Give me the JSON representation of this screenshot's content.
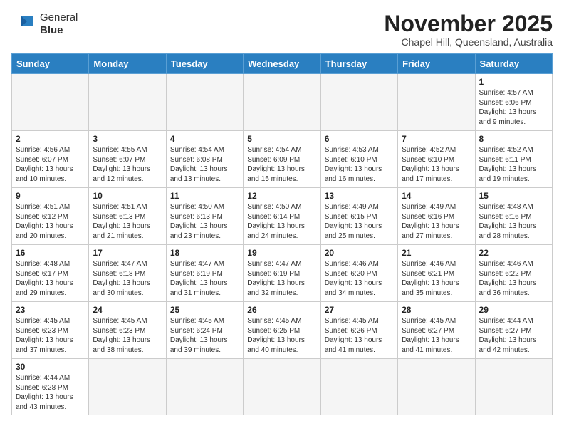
{
  "header": {
    "logo_general": "General",
    "logo_blue": "Blue",
    "month_title": "November 2025",
    "subtitle": "Chapel Hill, Queensland, Australia"
  },
  "days_of_week": [
    "Sunday",
    "Monday",
    "Tuesday",
    "Wednesday",
    "Thursday",
    "Friday",
    "Saturday"
  ],
  "weeks": [
    [
      {
        "day": "",
        "info": ""
      },
      {
        "day": "",
        "info": ""
      },
      {
        "day": "",
        "info": ""
      },
      {
        "day": "",
        "info": ""
      },
      {
        "day": "",
        "info": ""
      },
      {
        "day": "",
        "info": ""
      },
      {
        "day": "1",
        "info": "Sunrise: 4:57 AM\nSunset: 6:06 PM\nDaylight: 13 hours and 9 minutes."
      }
    ],
    [
      {
        "day": "2",
        "info": "Sunrise: 4:56 AM\nSunset: 6:07 PM\nDaylight: 13 hours and 10 minutes."
      },
      {
        "day": "3",
        "info": "Sunrise: 4:55 AM\nSunset: 6:07 PM\nDaylight: 13 hours and 12 minutes."
      },
      {
        "day": "4",
        "info": "Sunrise: 4:54 AM\nSunset: 6:08 PM\nDaylight: 13 hours and 13 minutes."
      },
      {
        "day": "5",
        "info": "Sunrise: 4:54 AM\nSunset: 6:09 PM\nDaylight: 13 hours and 15 minutes."
      },
      {
        "day": "6",
        "info": "Sunrise: 4:53 AM\nSunset: 6:10 PM\nDaylight: 13 hours and 16 minutes."
      },
      {
        "day": "7",
        "info": "Sunrise: 4:52 AM\nSunset: 6:10 PM\nDaylight: 13 hours and 17 minutes."
      },
      {
        "day": "8",
        "info": "Sunrise: 4:52 AM\nSunset: 6:11 PM\nDaylight: 13 hours and 19 minutes."
      }
    ],
    [
      {
        "day": "9",
        "info": "Sunrise: 4:51 AM\nSunset: 6:12 PM\nDaylight: 13 hours and 20 minutes."
      },
      {
        "day": "10",
        "info": "Sunrise: 4:51 AM\nSunset: 6:13 PM\nDaylight: 13 hours and 21 minutes."
      },
      {
        "day": "11",
        "info": "Sunrise: 4:50 AM\nSunset: 6:13 PM\nDaylight: 13 hours and 23 minutes."
      },
      {
        "day": "12",
        "info": "Sunrise: 4:50 AM\nSunset: 6:14 PM\nDaylight: 13 hours and 24 minutes."
      },
      {
        "day": "13",
        "info": "Sunrise: 4:49 AM\nSunset: 6:15 PM\nDaylight: 13 hours and 25 minutes."
      },
      {
        "day": "14",
        "info": "Sunrise: 4:49 AM\nSunset: 6:16 PM\nDaylight: 13 hours and 27 minutes."
      },
      {
        "day": "15",
        "info": "Sunrise: 4:48 AM\nSunset: 6:16 PM\nDaylight: 13 hours and 28 minutes."
      }
    ],
    [
      {
        "day": "16",
        "info": "Sunrise: 4:48 AM\nSunset: 6:17 PM\nDaylight: 13 hours and 29 minutes."
      },
      {
        "day": "17",
        "info": "Sunrise: 4:47 AM\nSunset: 6:18 PM\nDaylight: 13 hours and 30 minutes."
      },
      {
        "day": "18",
        "info": "Sunrise: 4:47 AM\nSunset: 6:19 PM\nDaylight: 13 hours and 31 minutes."
      },
      {
        "day": "19",
        "info": "Sunrise: 4:47 AM\nSunset: 6:19 PM\nDaylight: 13 hours and 32 minutes."
      },
      {
        "day": "20",
        "info": "Sunrise: 4:46 AM\nSunset: 6:20 PM\nDaylight: 13 hours and 34 minutes."
      },
      {
        "day": "21",
        "info": "Sunrise: 4:46 AM\nSunset: 6:21 PM\nDaylight: 13 hours and 35 minutes."
      },
      {
        "day": "22",
        "info": "Sunrise: 4:46 AM\nSunset: 6:22 PM\nDaylight: 13 hours and 36 minutes."
      }
    ],
    [
      {
        "day": "23",
        "info": "Sunrise: 4:45 AM\nSunset: 6:23 PM\nDaylight: 13 hours and 37 minutes."
      },
      {
        "day": "24",
        "info": "Sunrise: 4:45 AM\nSunset: 6:23 PM\nDaylight: 13 hours and 38 minutes."
      },
      {
        "day": "25",
        "info": "Sunrise: 4:45 AM\nSunset: 6:24 PM\nDaylight: 13 hours and 39 minutes."
      },
      {
        "day": "26",
        "info": "Sunrise: 4:45 AM\nSunset: 6:25 PM\nDaylight: 13 hours and 40 minutes."
      },
      {
        "day": "27",
        "info": "Sunrise: 4:45 AM\nSunset: 6:26 PM\nDaylight: 13 hours and 41 minutes."
      },
      {
        "day": "28",
        "info": "Sunrise: 4:45 AM\nSunset: 6:27 PM\nDaylight: 13 hours and 41 minutes."
      },
      {
        "day": "29",
        "info": "Sunrise: 4:44 AM\nSunset: 6:27 PM\nDaylight: 13 hours and 42 minutes."
      }
    ],
    [
      {
        "day": "30",
        "info": "Sunrise: 4:44 AM\nSunset: 6:28 PM\nDaylight: 13 hours and 43 minutes."
      },
      {
        "day": "",
        "info": ""
      },
      {
        "day": "",
        "info": ""
      },
      {
        "day": "",
        "info": ""
      },
      {
        "day": "",
        "info": ""
      },
      {
        "day": "",
        "info": ""
      },
      {
        "day": "",
        "info": ""
      }
    ]
  ]
}
